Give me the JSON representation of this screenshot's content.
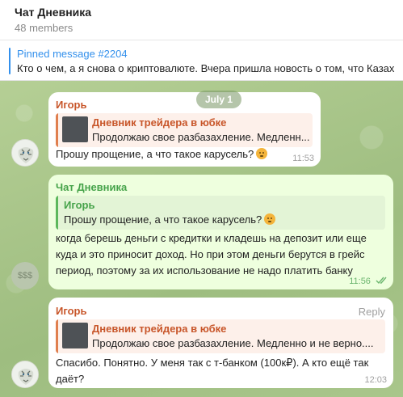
{
  "header": {
    "title": "Чат Дневника",
    "members": "48 members"
  },
  "pinned": {
    "title": "Pinned message #2204",
    "text": "Кто о чем, а я снова о криптовалюте. Вчера пришла новость о том, что Казах"
  },
  "date_pill": "July 1",
  "messages": [
    {
      "sender": "Игорь",
      "reply_title": "Дневник трейдера в юбке",
      "reply_text": "Продолжаю свое разбазахление. Медленн...",
      "text": "Прошу прощение, а что такое карусель?",
      "emoji": "grimacing-emoji",
      "time": "11:53",
      "avatar": "tiger-avatar"
    },
    {
      "sender": "Чат Дневника",
      "reply_title": "Игорь",
      "reply_text": "Прошу прощение, а что такое карусель?",
      "text_lines": [
        "когда берешь деньги с кредитки и кладешь на депозит или еще",
        "куда и это приносит доход. Но при этом деньги берутся в грейс",
        "период, поэтому за их использование не надо платить банку"
      ],
      "time": "11:56",
      "avatar_text": "$$$"
    },
    {
      "sender": "Игорь",
      "reply_label": "Reply",
      "reply_title": "Дневник трейдера в юбке",
      "reply_text": "Продолжаю свое разбазахление. Медленно и не верно....",
      "text_lines": [
        "Спасибо. Понятно. У меня так с т-банком (100к₽). А кто ещё так",
        "даёт?"
      ],
      "time": "12:03",
      "avatar": "tiger-avatar"
    }
  ]
}
